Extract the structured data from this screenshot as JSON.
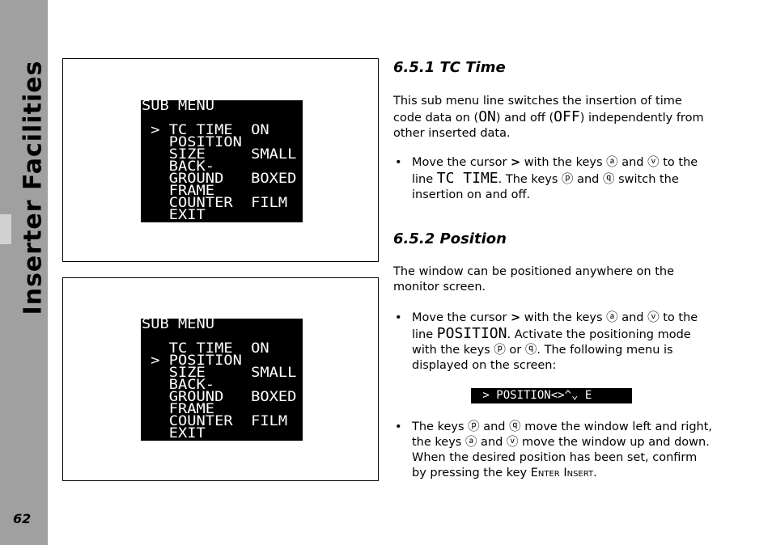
{
  "sidebar": {
    "title": "Inserter Facilities",
    "page_number": "62"
  },
  "screens": [
    {
      "lines": [
        "SUB MENU",
        "",
        " > TC TIME  ON",
        "   POSITION",
        "   SIZE     SMALL",
        "   BACK-",
        "   GROUND   BOXED",
        "   FRAME",
        "   COUNTER  FILM",
        "   EXIT"
      ]
    },
    {
      "lines": [
        "SUB MENU",
        "",
        "   TC TIME  ON",
        " > POSITION",
        "   SIZE     SMALL",
        "   BACK-",
        "   GROUND   BOXED",
        "   FRAME",
        "   COUNTER  FILM",
        "   EXIT"
      ]
    }
  ],
  "section1": {
    "heading": "6.5.1   TC Time",
    "para_a": "This sub menu line switches the insertion of time code data on (",
    "on": "ON",
    "para_b": ") and off (",
    "off": "OFF",
    "para_c": ") independently from other inserted data.",
    "bullet_a": "Move the cursor ",
    "cursor": ">",
    "bullet_b": " with the keys ⓐ and ⓥ to the line ",
    "line": "TC TIME",
    "bullet_c": ". The keys ⓟ and ⓠ switch the insertion on and off."
  },
  "section2": {
    "heading": "6.5.2   Position",
    "para": "The window can be positioned anywhere on the monitor screen.",
    "bullet1_a": "Move the cursor ",
    "cursor": ">",
    "bullet1_b": " with the keys ⓐ and ⓥ to the line ",
    "line": "POSITION",
    "bullet1_c": ". Activate the positioning mode with the keys ⓟ or ⓠ. The following menu is displayed on the screen:",
    "menu_bar": " > POSITION<>^⌄ E",
    "bullet2_a": "The keys ⓟ and ⓠ move the window left and right, the keys ⓐ and ⓥ move the window up and down. When the desired position has been set, confirm by pressing the key ",
    "key": "Enter Insert",
    "bullet2_b": "."
  }
}
